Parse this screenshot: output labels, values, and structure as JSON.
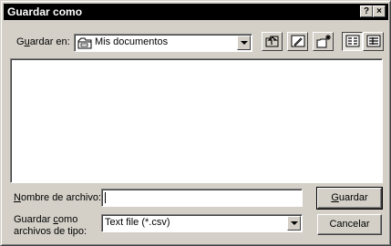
{
  "window": {
    "title": "Guardar como",
    "help_button": "?",
    "close_button": "×"
  },
  "save_in": {
    "label_pre": "G",
    "label_accel": "u",
    "label_post": "ardar en:",
    "value": "Mis documentos"
  },
  "toolbar": {
    "buttons": [
      "up-one-level",
      "desktop",
      "new-folder",
      "list-view",
      "details-view"
    ]
  },
  "filename": {
    "label_accel": "N",
    "label_post": "ombre de archivo:",
    "value": ""
  },
  "filetype": {
    "label_line1_pre": "Guardar ",
    "label_line1_accel": "c",
    "label_line1_post": "omo",
    "label_line2": "archivos de tipo:",
    "value": "Text file (*.csv)"
  },
  "buttons": {
    "save_accel": "G",
    "save_post": "uardar",
    "cancel": "Cancelar"
  }
}
